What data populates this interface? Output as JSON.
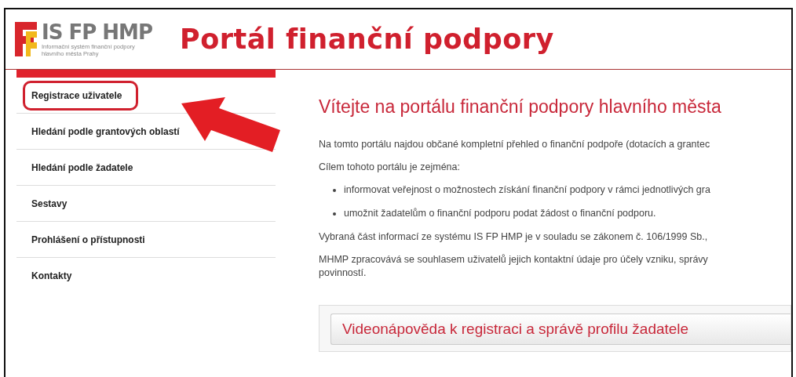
{
  "header": {
    "logo_title": "IS FP HMP",
    "logo_subtitle": [
      "Informační systém finanční podpory",
      "hlavního města Prahy"
    ],
    "title": "Portál finanční podpory"
  },
  "sidebar": {
    "items": [
      {
        "label": "Registrace uživatele",
        "highlighted": true
      },
      {
        "label": "Hledání podle grantových oblastí",
        "highlighted": false
      },
      {
        "label": "Hledání podle žadatele",
        "highlighted": false
      },
      {
        "label": "Sestavy",
        "highlighted": false
      },
      {
        "label": "Prohlášení o přístupnosti",
        "highlighted": false
      },
      {
        "label": "Kontakty",
        "highlighted": false
      }
    ]
  },
  "content": {
    "heading": "Vítejte na portálu finanční podpory hlavního města",
    "blocks": [
      {
        "kind": "paragraph",
        "lines": [
          "Na tomto portálu najdou občané kompletní přehled o finanční podpoře (dotacích a grantec"
        ]
      },
      {
        "kind": "paragraph",
        "lines": [
          "Cílem tohoto portálu je zejména:"
        ]
      },
      {
        "kind": "bullet",
        "lines": [
          "informovat veřejnost o možnostech získání finanční podpory v rámci jednotlivých gra"
        ]
      },
      {
        "kind": "bullet",
        "lines": [
          "umožnit žadatelům o finanční podporu podat žádost o finanční podporu."
        ]
      },
      {
        "kind": "paragraph",
        "lines": [
          "Vybraná část informací ze systému IS FP HMP je v souladu se zákonem č. 106/1999 Sb.,"
        ]
      },
      {
        "kind": "paragraph",
        "lines": [
          "MHMP zpracovává se souhlasem uživatelů jejich kontaktní údaje pro účely vzniku, správy",
          "povinností."
        ]
      }
    ],
    "video_button": "Videonápověda k registraci a správě profilu žadatele"
  }
}
